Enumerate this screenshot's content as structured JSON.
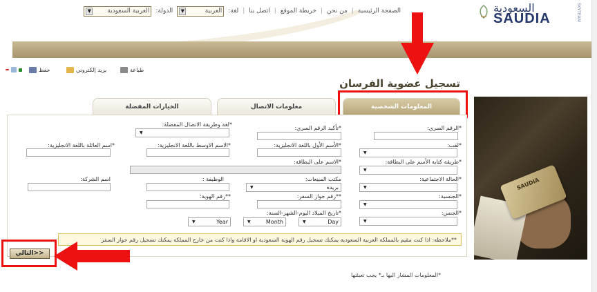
{
  "topnav": {
    "home": "الصفحة الرئيسية",
    "about": "من نحن",
    "sitemap": "خريطة الموقع",
    "contact": "اتصل بنا",
    "language_label": "لغة:",
    "language_value": "العربية",
    "country_label": "الدولة:",
    "country_value": "العربية السعودية"
  },
  "logo": {
    "arabic": "السعودية",
    "english": "SAUDIA",
    "sky": "SKYTEAM"
  },
  "toolbar": {
    "print": "طباعة",
    "email": "بريد إلكتروني",
    "save": "حفظ"
  },
  "page_title": "تسجيل عضوية الفرسان",
  "tabs": [
    {
      "label": "المعلومات الشخصية",
      "active": true
    },
    {
      "label": "معلومات الاتصال",
      "active": false
    },
    {
      "label": "الخيارات المفضلة",
      "active": false
    }
  ],
  "form": {
    "password": "*الرقم السري:",
    "confirm_password": "*تأكيد الرقم السري:",
    "contact_pref": "*لغة وطريقة الاتصال المفضلة:",
    "title_field": "*لقب:",
    "first_name_en": "*الأسم الأول باللغة الانجليزية:",
    "middle_name_en": "*الاسم الاوسط باللغة الانجليزية:",
    "family_name_en": "*اسم العائلة باللغة الانجليزية:",
    "name_on_card_method": "*طريقة كتابة الأسم على البطاقة:",
    "name_on_card": "*الاسم على البطاقة:",
    "marital_status": "*الحالة الاجتماعية:",
    "sales_office": "مكتب المبيعات:",
    "sales_office_value": "بريدة",
    "job": "الوظيفة :",
    "company": "اسم الشركة:",
    "nationality": "*الجنسية:",
    "passport": "**رقم جواز السفر:",
    "id_number": "**رقم الهوية:",
    "gender": "*الجنس:",
    "dob": "*تاريخ الميلاد اليوم-الشهر-السنة:",
    "day": "Day",
    "month": "Month",
    "year": "Year"
  },
  "note": "**ملاحظة: اذا كنت مقيم بالمملكة العربية السعودية يمكنك تسجيل رقم الهوية السعودية او الاقامة واذا كنت من خارج المملكة يمكنك تسجيل رقم جواز السفر",
  "next_button": "التالي>>",
  "footnote": "*المعلومات المشار اليها بـ* يجب تعبئتها",
  "colors": {
    "accent": "#b8a67a",
    "highlight": "#ee1111"
  }
}
